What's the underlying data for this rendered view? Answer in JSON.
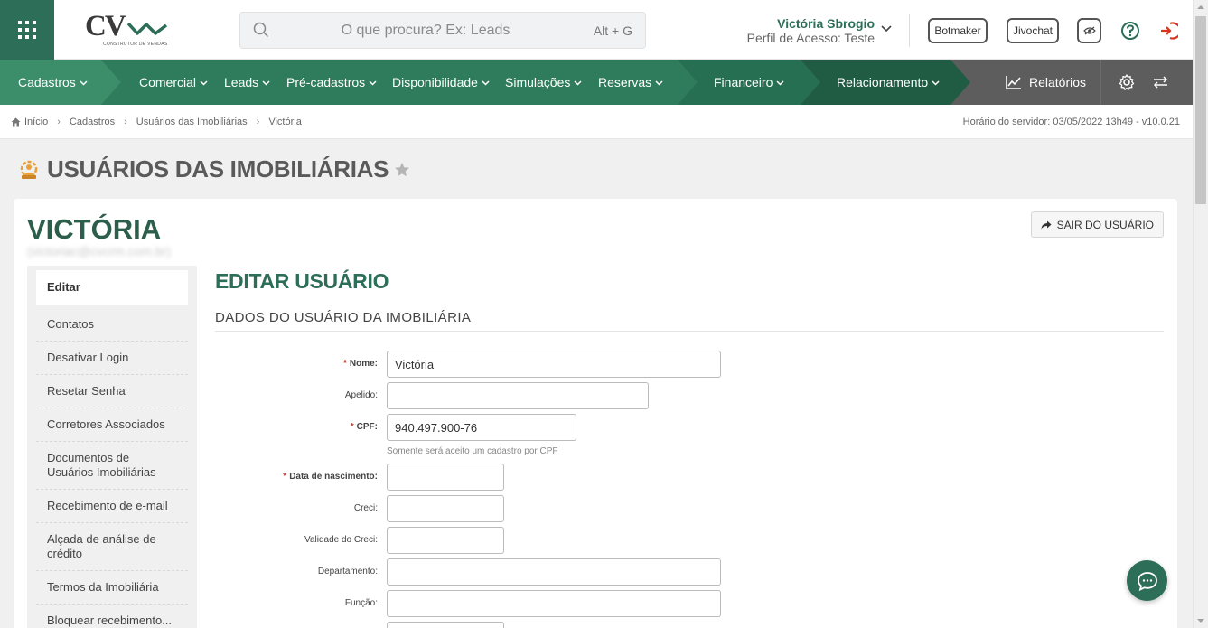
{
  "header": {
    "logo_text": "CV",
    "logo_subtitle": "CONSTRUTOR DE VENDAS",
    "search_placeholder": "O que procura? Ex: Leads",
    "search_shortcut": "Alt + G",
    "user_name": "Victória Sbrogio",
    "user_profile": "Perfil de Acesso: Teste",
    "botmaker_label": "Botmaker",
    "jivochat_label": "Jivochat"
  },
  "nav": {
    "items": [
      {
        "label": "Cadastros"
      },
      {
        "label": "Comercial"
      },
      {
        "label": "Leads"
      },
      {
        "label": "Pré-cadastros"
      },
      {
        "label": "Disponibilidade"
      },
      {
        "label": "Simulações"
      },
      {
        "label": "Reservas"
      },
      {
        "label": "Financeiro"
      },
      {
        "label": "Relacionamento"
      }
    ],
    "reports_label": "Relatórios",
    "colors": {
      "segment1": "#3c8e6b",
      "segment2": "#2f7c5c",
      "segment3": "#266b4f",
      "segment4": "#205c44",
      "rest": "#5d5d5d"
    }
  },
  "breadcrumb": {
    "items": [
      "Início",
      "Cadastros",
      "Usuários das Imobiliárias",
      "Victória"
    ],
    "server_time": "Horário do servidor: 03/05/2022 13h49 - v10.0.21"
  },
  "page": {
    "title": "USUÁRIOS DAS IMOBILIÁRIAS",
    "user_title": "VICTÓRIA",
    "user_email": "(victoriac@cvcrm.com.br)",
    "logout_label": "SAIR DO USUÁRIO"
  },
  "sidemenu": {
    "items": [
      "Editar",
      "Contatos",
      "Desativar Login",
      "Resetar Senha",
      "Corretores Associados",
      "Documentos de Usuários Imobiliárias",
      "Recebimento de e-mail",
      "Alçada de análise de crédito",
      "Termos da Imobiliária",
      "Bloquear recebimento..."
    ]
  },
  "form": {
    "title": "EDITAR USUÁRIO",
    "section": "DADOS DO USUÁRIO DA IMOBILIÁRIA",
    "required_marker": "*",
    "fields": {
      "nome": {
        "label": "Nome:",
        "value": "Victória"
      },
      "apelido": {
        "label": "Apelido:",
        "value": ""
      },
      "cpf": {
        "label": "CPF:",
        "value": "940.497.900-76",
        "hint": "Somente será aceito um cadastro por CPF"
      },
      "nascimento": {
        "label": "Data de nascimento:",
        "value": ""
      },
      "creci": {
        "label": "Creci:",
        "value": ""
      },
      "validade_creci": {
        "label": "Validade do Creci:",
        "value": ""
      },
      "departamento": {
        "label": "Departamento:",
        "value": ""
      },
      "funcao": {
        "label": "Função:",
        "value": ""
      }
    }
  },
  "colors": {
    "brand": "#2c6e57",
    "danger": "#d9341e"
  }
}
